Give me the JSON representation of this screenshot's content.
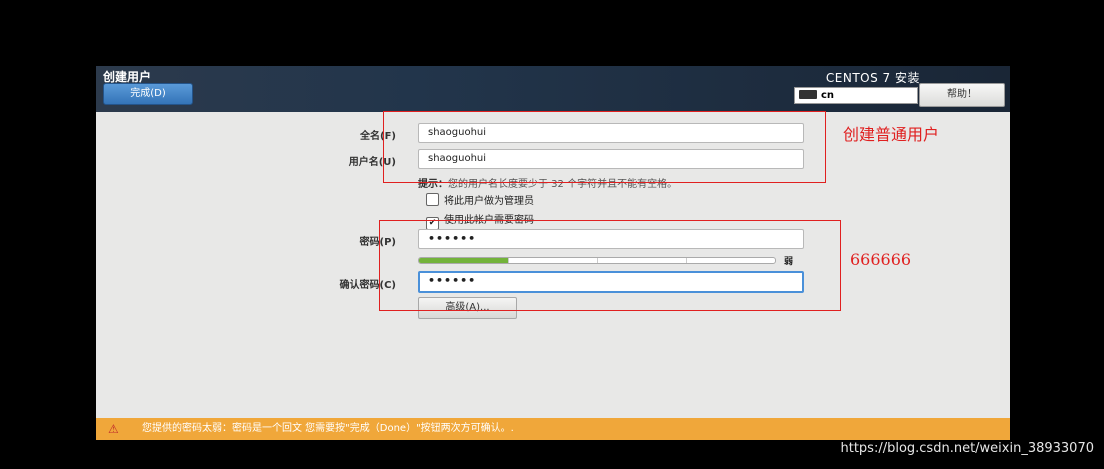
{
  "header": {
    "title": "创建用户",
    "done_label": "完成(D)",
    "product": "CENTOS 7 安装",
    "keyboard": "cn",
    "help_label": "帮助！"
  },
  "form": {
    "fullname_label": "全名(F)",
    "fullname_value": "shaoguohui",
    "username_label": "用户名(U)",
    "username_value": "shaoguohui",
    "hint_prefix": "提示：",
    "hint_text": "您的用户名长度要少于 32 个字符并且不能有空格。",
    "admin_check_label": "将此用户做为管理员",
    "password_check_label": "使用此帐户需要密码",
    "password_label": "密码(P)",
    "password_value": "••••••",
    "strength": 0.25,
    "strength_label": "弱",
    "confirm_label": "确认密码(C)",
    "confirm_value": "••••••",
    "advanced_label": "高级(A)..."
  },
  "warning": {
    "text": "您提供的密码太弱：密码是一个回文 您需要按\"完成（Done）\"按钮两次方可确认。."
  },
  "annotations": {
    "user_note": "创建普通用户",
    "password_note": "666666"
  },
  "watermark": "https://blog.csdn.net/weixin_38933070"
}
